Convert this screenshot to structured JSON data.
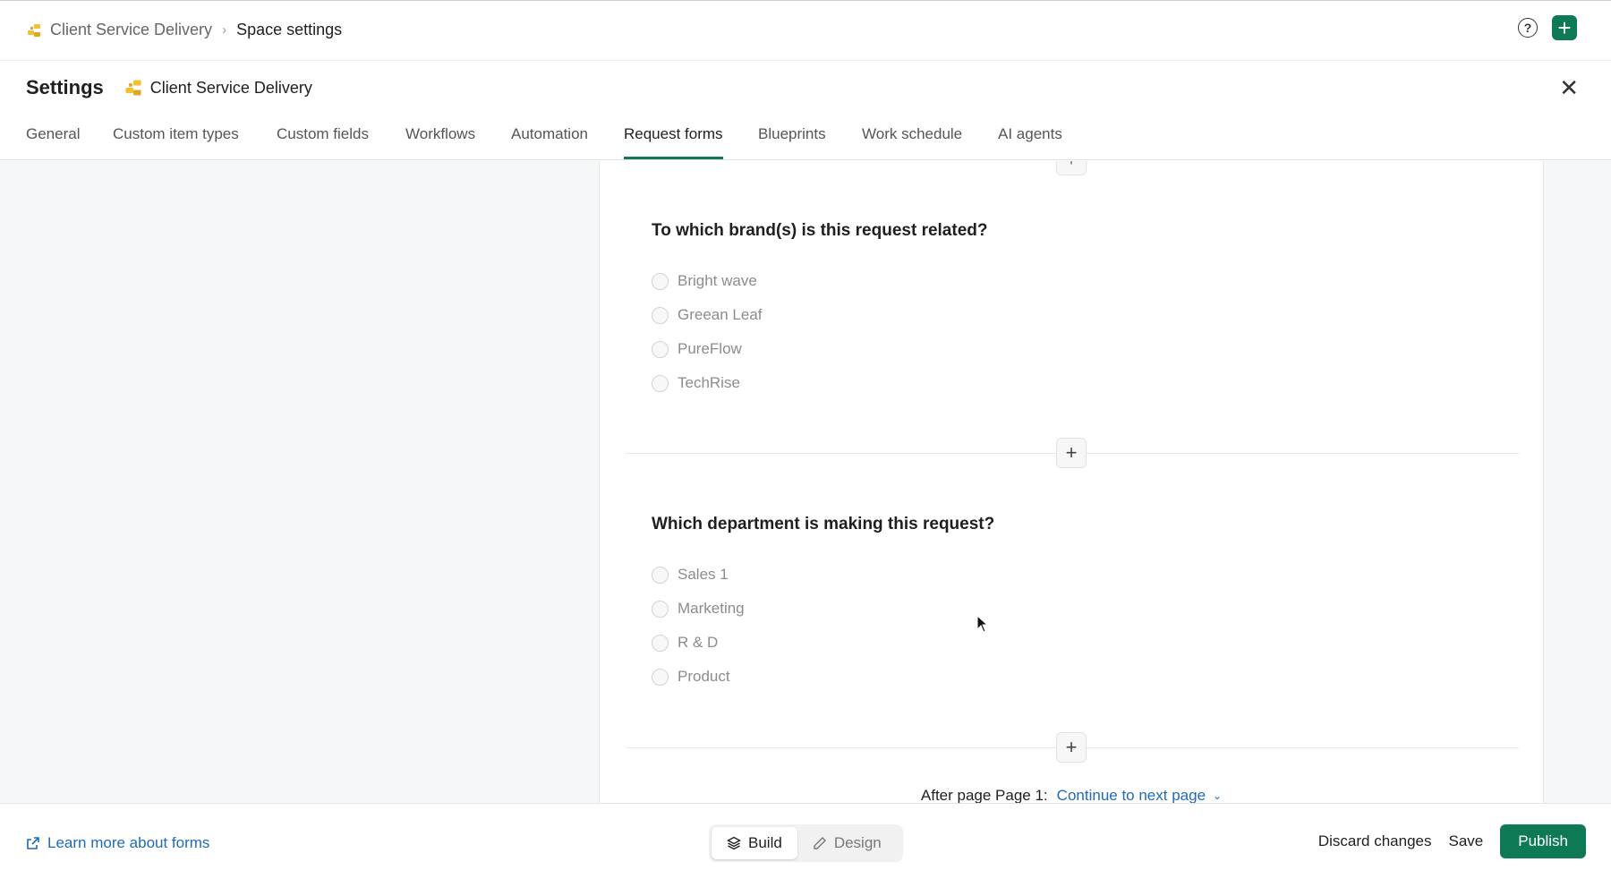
{
  "breadcrumb": {
    "space": "Client Service Delivery",
    "separator": ">",
    "current": "Space settings"
  },
  "header": {
    "help_icon": "help-circle-icon",
    "add_icon": "plus-icon",
    "title": "Settings",
    "space_name": "Client Service Delivery",
    "close_icon": "close-icon"
  },
  "tabs": [
    {
      "label": "General"
    },
    {
      "label": "Custom item types"
    },
    {
      "label": "Custom fields"
    },
    {
      "label": "Workflows"
    },
    {
      "label": "Automation"
    },
    {
      "label": "Request forms",
      "active": true
    },
    {
      "label": "Blueprints"
    },
    {
      "label": "Work schedule"
    },
    {
      "label": "AI agents"
    }
  ],
  "form": {
    "questions": [
      {
        "title": "To which brand(s) is this request related?",
        "options": [
          "Bright wave",
          "Greean Leaf",
          "PureFlow",
          "TechRise"
        ]
      },
      {
        "title": "Which department is making this request?",
        "options": [
          "Sales 1",
          "Marketing",
          "R & D",
          "Product"
        ]
      }
    ],
    "add_symbol": "+",
    "after_page_label": "After page Page 1:",
    "after_page_action": "Continue to next page"
  },
  "footer": {
    "learn_more": "Learn more about forms",
    "modes": {
      "build": "Build",
      "design": "Design",
      "active": "build"
    },
    "discard": "Discard changes",
    "save": "Save",
    "publish": "Publish"
  },
  "colors": {
    "accent": "#0e7a55",
    "link": "#1e6bb8",
    "space_icon": "#f2c12e"
  }
}
